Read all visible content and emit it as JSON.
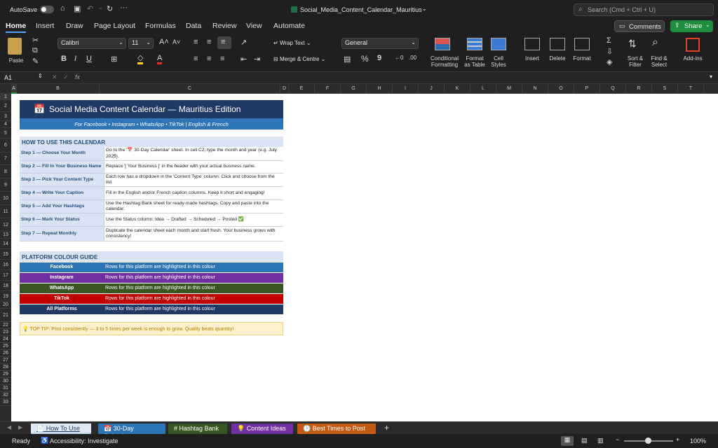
{
  "titlebar": {
    "autosave": "AutoSave",
    "file_name": "Social_Media_Content_Calendar_Mauritius",
    "search_placeholder": "Search (Cmd + Ctrl + U)"
  },
  "menu": {
    "tabs": [
      "Home",
      "Insert",
      "Draw",
      "Page Layout",
      "Formulas",
      "Data",
      "Review",
      "View",
      "Automate"
    ],
    "comments": "Comments",
    "share": "Share"
  },
  "ribbon": {
    "paste": "Paste",
    "font_name": "Calibri",
    "font_size": "11",
    "wrap_text": "Wrap Text",
    "merge_centre": "Merge & Centre",
    "number_format": "General",
    "conditional": "Conditional",
    "formatting": "Formatting",
    "format_as": "Format",
    "as_table": "as Table",
    "cell": "Cell",
    "styles": "Styles",
    "insert": "Insert",
    "delete": "Delete",
    "format": "Format",
    "sort": "Sort &",
    "filter": "Filter",
    "find": "Find &",
    "select": "Select",
    "addins": "Add-ins",
    "percent": "%",
    "comma": "9"
  },
  "formula_bar": {
    "name_box": "A1",
    "fx": "fx",
    "formula": ""
  },
  "columns": [
    "A",
    "B",
    "C",
    "D",
    "E",
    "F",
    "G",
    "H",
    "I",
    "J",
    "K",
    "L",
    "M",
    "N",
    "O",
    "P",
    "Q",
    "R",
    "S",
    "T"
  ],
  "rows": [
    "1",
    "2",
    "3",
    "4",
    "5",
    "6",
    "7",
    "8",
    "9",
    "10",
    "11",
    "12",
    "13",
    "14",
    "15",
    "16",
    "17",
    "18",
    "19",
    "20",
    "21",
    "22",
    "23",
    "24",
    "25",
    "26",
    "27",
    "28",
    "29",
    "30",
    "31",
    "32",
    "33"
  ],
  "sheet": {
    "title": "Social Media Content Calendar — Mauritius Edition",
    "title_icon": "📅",
    "subtitle": "For Facebook • Instagram • WhatsApp • TikTok  |  English & French",
    "howto_header": "HOW TO USE THIS CALENDAR",
    "steps": [
      {
        "label": "Step 1 — Choose Your Month",
        "text": "Go to the '📅 30-Day Calendar' sheet. In cell C2, type the month and year (e.g. July 2025)."
      },
      {
        "label": "Step 2 — Fill In Your Business Name",
        "text": "Replace '[ Your Business ]' in the header with your actual business name."
      },
      {
        "label": "Step 3 — Pick Your Content Type",
        "text": "Each row has a dropdown in the 'Content Type' column. Click and choose from the list."
      },
      {
        "label": "Step 4 — Write Your Caption",
        "text": "Fill in the English and/or French caption columns. Keep it short and engaging!"
      },
      {
        "label": "Step 5 — Add Your Hashtags",
        "text": "Use the Hashtag Bank sheet for ready-made hashtags. Copy and paste into the calendar."
      },
      {
        "label": "Step 6 — Mark Your Status",
        "text": "Use the Status column: Idea → Drafted → Scheduled → Posted ✅"
      },
      {
        "label": "Step 7 — Repeat Monthly",
        "text": "Duplicate the calendar sheet each month and start fresh. Your business grows with consistency!"
      }
    ],
    "platform_header": "PLATFORM COLOUR GUIDE",
    "platforms": [
      {
        "name": "Facebook",
        "desc": "Rows for this platform are highlighted in this colour",
        "color": "#2e75b6"
      },
      {
        "name": "Instagram",
        "desc": "Rows for this platform are highlighted in this colour",
        "color": "#7030a0"
      },
      {
        "name": "WhatsApp",
        "desc": "Rows for this platform are highlighted in this colour",
        "color": "#375623"
      },
      {
        "name": "TikTok",
        "desc": "Rows for this platform are highlighted in this colour",
        "color": "#c00000"
      },
      {
        "name": "All Platforms",
        "desc": "Rows for this platform are highlighted in this colour",
        "color": "#1f3864"
      }
    ],
    "tip": "💡 TOP TIP: Post consistently — 3 to 5 times per week is enough to grow. Quality beats quantity!"
  },
  "sheet_tabs": [
    {
      "label": "📄 How To Use",
      "active": true,
      "color": "#bdd7ee"
    },
    {
      "label": "📅 30-Day Calendar",
      "active": false,
      "color": "#2e75b6"
    },
    {
      "label": "# Hashtag Bank",
      "active": false,
      "color": "#375623"
    },
    {
      "label": "💡 Content Ideas",
      "active": false,
      "color": "#7030a0"
    },
    {
      "label": "🕒 Best Times to Post",
      "active": false,
      "color": "#c55a11"
    }
  ],
  "status": {
    "ready": "Ready",
    "accessibility": "Accessibility: Investigate",
    "zoom": "100%"
  }
}
